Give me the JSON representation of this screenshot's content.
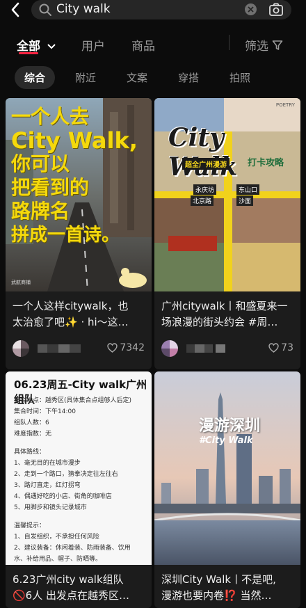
{
  "search": {
    "query": "City walk"
  },
  "tabs": [
    {
      "label": "全部"
    },
    {
      "label": "用户"
    },
    {
      "label": "商品"
    }
  ],
  "filter_label": "筛选",
  "chips": [
    "综合",
    "附近",
    "文案",
    "穿搭",
    "拍照"
  ],
  "cards": [
    {
      "cover_text": [
        "一个人去",
        "City Walk,",
        "你可以",
        "把看到的",
        "路牌名",
        "拼成一首诗。"
      ],
      "cover_tag": "武航商铺",
      "caption_line1": "一个人这样citywalk，也",
      "caption_line2": "太治愈了吧✨ · hi～这…",
      "likes": "7342"
    },
    {
      "cover_title": "City Walk",
      "cover_subtitle": "超全广州漫游",
      "cover_badge": "打卡攻略",
      "cover_places": [
        "东山口",
        "北京路",
        "永庆坊",
        "沙面"
      ],
      "cover_corner": "POETRY",
      "caption_line1": "广州citywalk丨和盛夏来一",
      "caption_line2": "场浪漫的街头约会 #周…",
      "likes": "73"
    },
    {
      "doc_title": "06.23周五-City walk广州组队",
      "doc_lines": [
        "集合地点：越秀区(具体集合点组够人后定)",
        "集合时间：下午14:00",
        "组队人数：6",
        "难度指数：无",
        "",
        "具体路线：",
        "1、毫无目的在城市漫步",
        "2、走到一个路口，猜拳决定往左往右",
        "3、路灯直走，红灯拐弯",
        "4、偶遇好吃的小店、街角的咖啡店",
        "5、用脚步和镜头记录城市",
        "",
        "温馨提示：",
        "1、自发组织，不承担任何风险",
        "2、建议装备：休闲着装、防雨装备、饮用",
        "水、补给用品、帽子、防晒等。"
      ],
      "caption_line1": "6.23广州city walk组队",
      "caption_line2": "🚫6人 出发点在越秀区…"
    },
    {
      "cover_title": "漫游深圳",
      "cover_subtitle": "#City Walk",
      "caption_line1": "深圳City Walk丨不是吧,",
      "caption_line2": "漫游也要内卷⁉️ 当然…"
    }
  ]
}
